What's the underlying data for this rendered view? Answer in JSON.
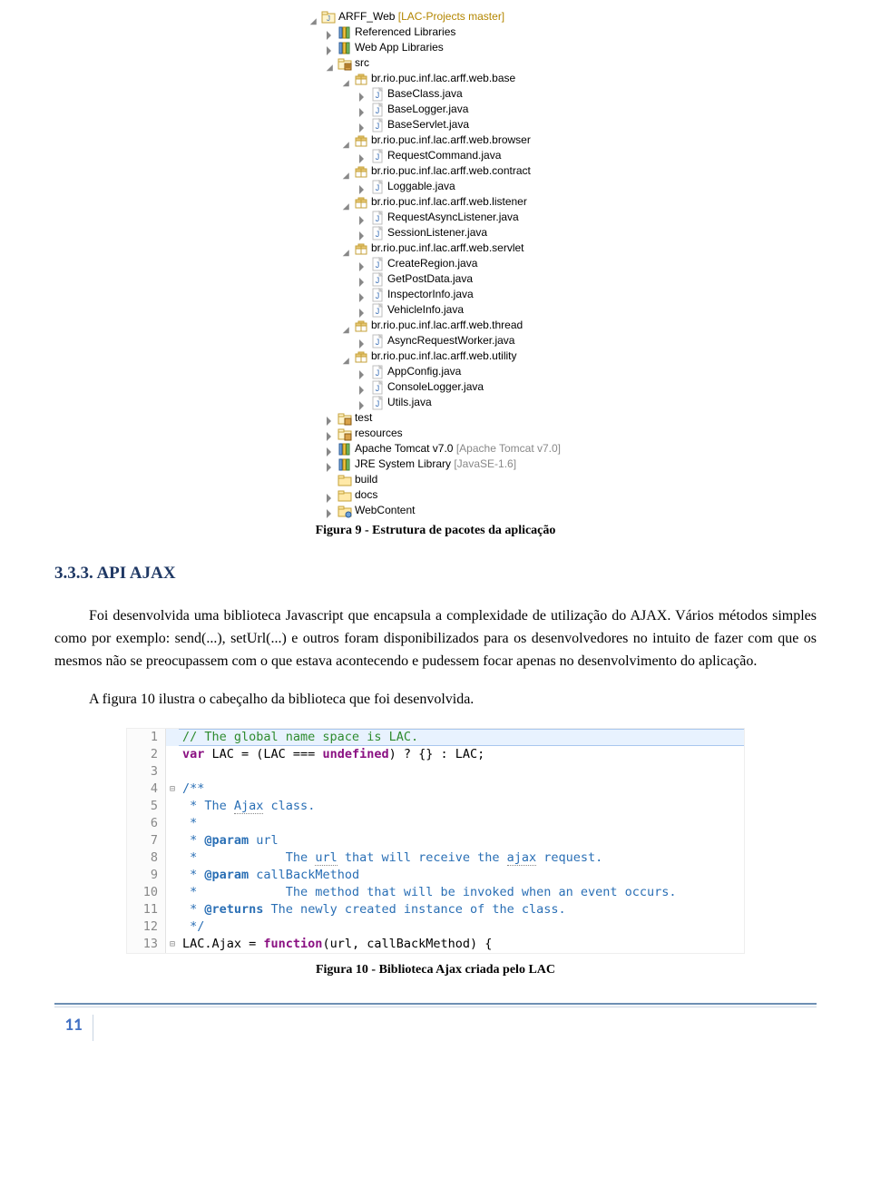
{
  "tree": {
    "project_name": "ARFF_Web",
    "project_deco": "[LAC-Projects master]",
    "referenced_libs": "Referenced Libraries",
    "web_app_libs": "Web App Libraries",
    "src": "src",
    "pkg_base": "br.rio.puc.inf.lac.arff.web.base",
    "base_files": [
      "BaseClass.java",
      "BaseLogger.java",
      "BaseServlet.java"
    ],
    "pkg_browser": "br.rio.puc.inf.lac.arff.web.browser",
    "browser_files": [
      "RequestCommand.java"
    ],
    "pkg_contract": "br.rio.puc.inf.lac.arff.web.contract",
    "contract_files": [
      "Loggable.java"
    ],
    "pkg_listener": "br.rio.puc.inf.lac.arff.web.listener",
    "listener_files": [
      "RequestAsyncListener.java",
      "SessionListener.java"
    ],
    "pkg_servlet": "br.rio.puc.inf.lac.arff.web.servlet",
    "servlet_files": [
      "CreateRegion.java",
      "GetPostData.java",
      "InspectorInfo.java",
      "VehicleInfo.java"
    ],
    "pkg_thread": "br.rio.puc.inf.lac.arff.web.thread",
    "thread_files": [
      "AsyncRequestWorker.java"
    ],
    "pkg_utility": "br.rio.puc.inf.lac.arff.web.utility",
    "utility_files": [
      "AppConfig.java",
      "ConsoleLogger.java",
      "Utils.java"
    ],
    "test": "test",
    "resources": "resources",
    "tomcat": "Apache Tomcat v7.0",
    "tomcat_deco": "[Apache Tomcat v7.0]",
    "jre": "JRE System Library",
    "jre_deco": "[JavaSE-1.6]",
    "build": "build",
    "docs": "docs",
    "webcontent": "WebContent"
  },
  "fig9_caption": "Figura 9 - Estrutura de pacotes da aplicação",
  "heading": "3.3.3. API AJAX",
  "para1": "Foi desenvolvida uma biblioteca Javascript que encapsula a complexidade de utilização do AJAX. Vários métodos simples como por exemplo: send(...), setUrl(...) e outros foram disponibilizados para os desenvolvedores no intuito de fazer com que os mesmos não se preocupassem com o que estava acontecendo e pudessem focar apenas no desenvolvimento do aplicação.",
  "para2": "A figura 10 ilustra o cabeçalho da biblioteca que foi desenvolvida.",
  "code": {
    "lines": [
      {
        "n": "1",
        "fold": "",
        "hl": true,
        "segs": [
          {
            "cls": "c-comment",
            "t": "// The global name space is LAC."
          }
        ]
      },
      {
        "n": "2",
        "fold": "",
        "segs": [
          {
            "cls": "c-keyword",
            "t": "var"
          },
          {
            "cls": "",
            "t": " LAC = (LAC === "
          },
          {
            "cls": "c-const",
            "t": "undefined"
          },
          {
            "cls": "",
            "t": ") ? {} : LAC;"
          }
        ]
      },
      {
        "n": "3",
        "fold": "",
        "segs": [
          {
            "cls": "",
            "t": ""
          }
        ]
      },
      {
        "n": "4",
        "fold": "⊟",
        "segs": [
          {
            "cls": "c-jsdoc",
            "t": "/**"
          }
        ]
      },
      {
        "n": "5",
        "fold": "",
        "segs": [
          {
            "cls": "c-jsdoc",
            "t": " * The "
          },
          {
            "cls": "c-jsdoc squig",
            "t": "Ajax"
          },
          {
            "cls": "c-jsdoc",
            "t": " class."
          }
        ]
      },
      {
        "n": "6",
        "fold": "",
        "segs": [
          {
            "cls": "c-jsdoc",
            "t": " *"
          }
        ]
      },
      {
        "n": "7",
        "fold": "",
        "segs": [
          {
            "cls": "c-jsdoc",
            "t": " * "
          },
          {
            "cls": "c-jsdoc-tag",
            "t": "@param"
          },
          {
            "cls": "c-jsdoc",
            "t": " url"
          }
        ]
      },
      {
        "n": "8",
        "fold": "",
        "segs": [
          {
            "cls": "c-jsdoc",
            "t": " *            The "
          },
          {
            "cls": "c-jsdoc squig",
            "t": "url"
          },
          {
            "cls": "c-jsdoc",
            "t": " that will receive the "
          },
          {
            "cls": "c-jsdoc squig",
            "t": "ajax"
          },
          {
            "cls": "c-jsdoc",
            "t": " request."
          }
        ]
      },
      {
        "n": "9",
        "fold": "",
        "segs": [
          {
            "cls": "c-jsdoc",
            "t": " * "
          },
          {
            "cls": "c-jsdoc-tag",
            "t": "@param"
          },
          {
            "cls": "c-jsdoc",
            "t": " callBackMethod"
          }
        ]
      },
      {
        "n": "10",
        "fold": "",
        "segs": [
          {
            "cls": "c-jsdoc",
            "t": " *            The method that will be invoked when an event occurs."
          }
        ]
      },
      {
        "n": "11",
        "fold": "",
        "segs": [
          {
            "cls": "c-jsdoc",
            "t": " * "
          },
          {
            "cls": "c-jsdoc-tag",
            "t": "@returns"
          },
          {
            "cls": "c-jsdoc",
            "t": " The newly created instance of the class."
          }
        ]
      },
      {
        "n": "12",
        "fold": "",
        "segs": [
          {
            "cls": "c-jsdoc",
            "t": " */"
          }
        ]
      },
      {
        "n": "13",
        "fold": "⊟",
        "segs": [
          {
            "cls": "",
            "t": "LAC.Ajax = "
          },
          {
            "cls": "c-keyword",
            "t": "function"
          },
          {
            "cls": "",
            "t": "(url, callBackMethod) {"
          }
        ]
      }
    ]
  },
  "fig10_caption": "Figura 10 - Biblioteca Ajax criada pelo LAC",
  "page_number": "11"
}
